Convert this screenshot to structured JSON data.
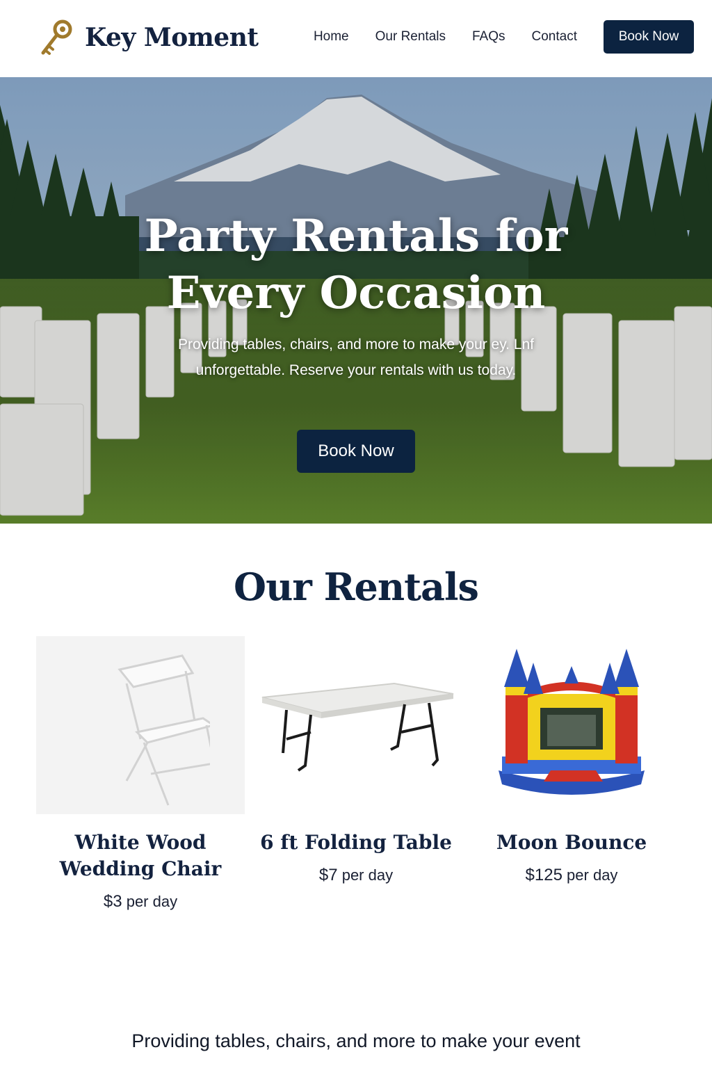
{
  "brand": {
    "name": "Key Moment"
  },
  "nav": {
    "items": [
      "Home",
      "Our Rentals",
      "FAQs",
      "Contact"
    ],
    "cta": "Book Now"
  },
  "hero": {
    "title_line1": "Party Rentals for",
    "title_line2": "Every Occasion",
    "subtitle": "Providing tables, chairs, and more to make your ey. Lnf unforgettable. Reserve your rentals with us today.",
    "cta": "Book Now"
  },
  "rentals": {
    "title": "Our Rentals",
    "items": [
      {
        "name": "White Wood Wedding Chair",
        "price": "$3",
        "unit": " per day"
      },
      {
        "name": "6 ft Folding Table",
        "price": "$7",
        "unit": " per day"
      },
      {
        "name": "Moon Bounce",
        "price": "$125",
        "unit": " per day"
      }
    ]
  },
  "footer": {
    "text": "Providing tables, chairs, and more to make your event"
  },
  "colors": {
    "navy": "#0c2340",
    "key_gold": "#a07a2c",
    "grass": "#5e8a2c"
  },
  "icons": {
    "logo": "key-icon"
  }
}
